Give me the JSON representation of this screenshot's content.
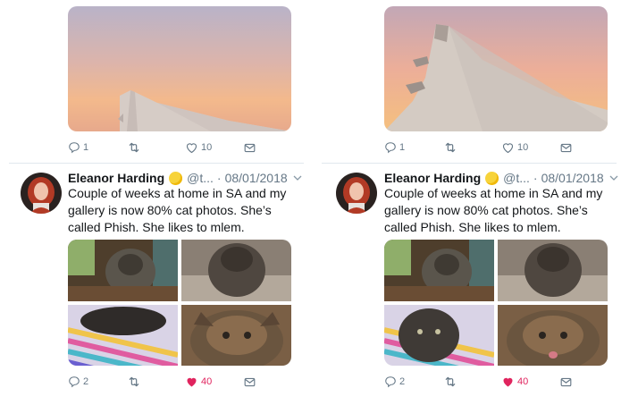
{
  "tweets": [
    {
      "id": "left",
      "top_actions": {
        "replies": "1",
        "retweets": "",
        "likes": "10"
      },
      "author": {
        "name": "Eleanor Harding",
        "handle": "@t...",
        "date": "08/01/2018"
      },
      "separator": "·",
      "text": "Couple of weeks at home in SA and my gallery is now 80% cat photos. She’s called Phish. She likes to mlem.",
      "bottom_actions": {
        "replies": "2",
        "retweets": "",
        "likes": "40"
      },
      "liked": true
    },
    {
      "id": "right",
      "top_actions": {
        "replies": "1",
        "retweets": "",
        "likes": "10"
      },
      "author": {
        "name": "Eleanor Harding",
        "handle": "@t...",
        "date": "08/01/2018"
      },
      "separator": "·",
      "text": "Couple of weeks at home in SA and my gallery is now 80% cat photos. She’s called Phish. She likes to mlem.",
      "bottom_actions": {
        "replies": "2",
        "retweets": "",
        "likes": "40"
      },
      "liked": true
    }
  ],
  "colors": {
    "like": "#e0245e",
    "secondary": "#657786",
    "divider": "#e1e8ed",
    "badge": "#f7d33a"
  },
  "icons": [
    "reply-icon",
    "retweet-icon",
    "like-icon",
    "message-icon",
    "caret-down-icon",
    "verified-badge-icon"
  ]
}
